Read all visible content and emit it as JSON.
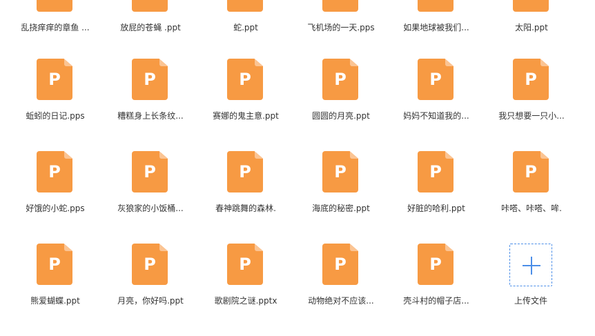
{
  "accent_color": "#f79a43",
  "upload_color": "#4b8ee8",
  "files": [
    {
      "name": "乱挠痒痒的章鱼 ...",
      "icon": "ppt-file-icon",
      "badge": "P"
    },
    {
      "name": "放屁的苍蝇 .ppt",
      "icon": "ppt-file-icon",
      "badge": "P"
    },
    {
      "name": "蛇.ppt",
      "icon": "ppt-file-icon",
      "badge": "P"
    },
    {
      "name": "飞机场的一天.pps",
      "icon": "ppt-file-icon",
      "badge": "P"
    },
    {
      "name": "如果地球被我们...",
      "icon": "ppt-file-icon",
      "badge": "P"
    },
    {
      "name": "太阳.ppt",
      "icon": "ppt-file-icon",
      "badge": "P"
    },
    {
      "name": "蚯蚓的日记.pps",
      "icon": "ppt-file-icon",
      "badge": "P"
    },
    {
      "name": "糟糕身上长条纹...",
      "icon": "ppt-file-icon",
      "badge": "P"
    },
    {
      "name": "赛娜的鬼主意.ppt",
      "icon": "ppt-file-icon",
      "badge": "P"
    },
    {
      "name": "圆圆的月亮.ppt",
      "icon": "ppt-file-icon",
      "badge": "P"
    },
    {
      "name": "妈妈不知道我的...",
      "icon": "ppt-file-icon",
      "badge": "P"
    },
    {
      "name": "我只想要一只小...",
      "icon": "ppt-file-icon",
      "badge": "P"
    },
    {
      "name": "好饿的小蛇.pps",
      "icon": "ppt-file-icon",
      "badge": "P"
    },
    {
      "name": "灰狼家的小饭桶...",
      "icon": "ppt-file-icon",
      "badge": "P"
    },
    {
      "name": "春神跳舞的森林.",
      "icon": "ppt-file-icon",
      "badge": "P"
    },
    {
      "name": "海底的秘密.ppt",
      "icon": "ppt-file-icon",
      "badge": "P"
    },
    {
      "name": "好脏的哈利.ppt",
      "icon": "ppt-file-icon",
      "badge": "P"
    },
    {
      "name": "咔嗒、咔嗒、哞.",
      "icon": "ppt-file-icon",
      "badge": "P"
    },
    {
      "name": "熊爱蝴蝶.ppt",
      "icon": "ppt-file-icon",
      "badge": "P"
    },
    {
      "name": "月亮，你好吗.ppt",
      "icon": "ppt-file-icon",
      "badge": "P"
    },
    {
      "name": "歌剧院之谜.pptx",
      "icon": "ppt-file-icon",
      "badge": "P"
    },
    {
      "name": "动物绝对不应该...",
      "icon": "ppt-file-icon",
      "badge": "P"
    },
    {
      "name": "壳斗村的帽子店...",
      "icon": "ppt-file-icon",
      "badge": "P"
    }
  ],
  "upload": {
    "label": "上传文件",
    "icon": "plus-icon"
  }
}
